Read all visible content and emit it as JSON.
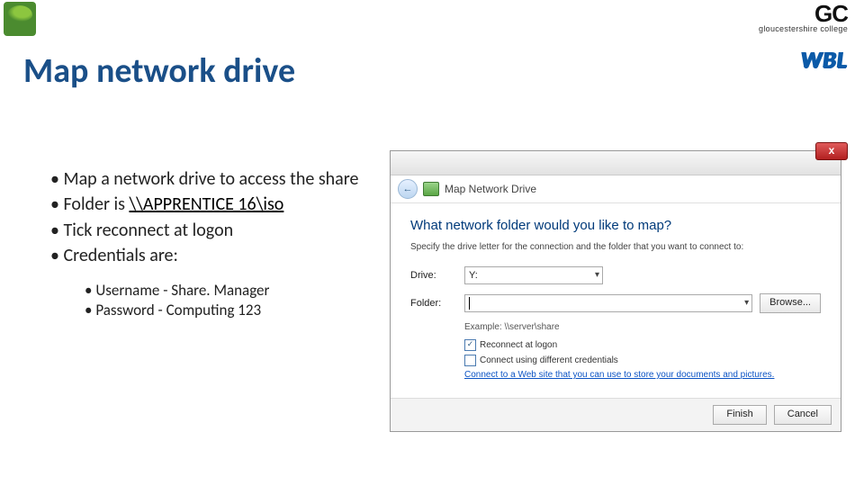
{
  "logos": {
    "gc_big": "GC",
    "gc_small": "gloucestershire college",
    "wbl": "WBL"
  },
  "title": "Map network drive",
  "bullets": {
    "b1": "Map a network drive to access the share",
    "b2_prefix": "Folder is ",
    "b2_link": "\\\\APPRENTICE 16\\iso",
    "b3": "Tick reconnect at logon",
    "b4": "Credentials are:",
    "sub1": "Username - Share. Manager",
    "sub2": "Password - Computing 123"
  },
  "dialog": {
    "nav_label": "Map Network Drive",
    "close": "x",
    "question": "What network folder would you like to map?",
    "instruction": "Specify the drive letter for the connection and the folder that you want to connect to:",
    "drive_label": "Drive:",
    "drive_value": "Y:",
    "folder_label": "Folder:",
    "folder_value": "",
    "browse": "Browse...",
    "example": "Example: \\\\server\\share",
    "reconnect": "Reconnect at logon",
    "diffcreds": "Connect using different credentials",
    "link": "Connect to a Web site that you can use to store your documents and pictures.",
    "finish": "Finish",
    "cancel": "Cancel"
  }
}
